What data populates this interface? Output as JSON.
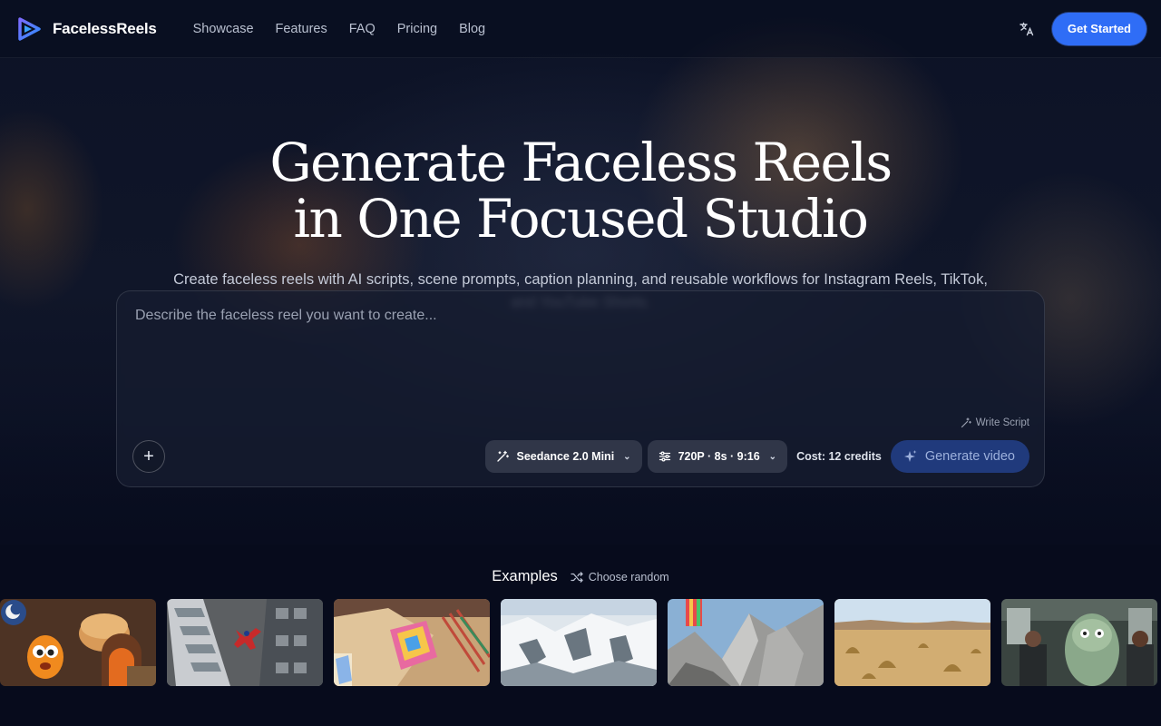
{
  "brand": {
    "name": "FacelessReels"
  },
  "nav": {
    "items": [
      {
        "label": "Showcase"
      },
      {
        "label": "Features"
      },
      {
        "label": "FAQ"
      },
      {
        "label": "Pricing"
      },
      {
        "label": "Blog"
      }
    ]
  },
  "header": {
    "language_icon": "translate-icon",
    "cta_label": "Get Started"
  },
  "hero": {
    "title_line1": "Generate Faceless Reels",
    "title_line2": "in One Focused Studio",
    "subtitle": "Create faceless reels with AI scripts, scene prompts, caption planning, and reusable workflows for Instagram Reels, TikTok, and YouTube Shorts."
  },
  "composer": {
    "placeholder": "Describe the faceless reel you want to create...",
    "write_script_label": "Write Script",
    "model_label": "Seedance 2.0 Mini",
    "settings_label": "720P · 8s · 9:16",
    "cost_label": "Cost: 12 credits",
    "generate_label": "Generate video"
  },
  "examples": {
    "title": "Examples",
    "choose_random_label": "Choose random",
    "thumbnails": [
      {
        "subject": "orange cartoon character with bread loaf"
      },
      {
        "subject": "person falling between skyscrapers"
      },
      {
        "subject": "colorful book on desk"
      },
      {
        "subject": "snowy mountain aerial"
      },
      {
        "subject": "rocky cliff with paraglider"
      },
      {
        "subject": "desert landscape"
      },
      {
        "subject": "furry monster on subway"
      }
    ]
  },
  "colors": {
    "accent": "#2f6df6",
    "background": "#070b1c"
  }
}
